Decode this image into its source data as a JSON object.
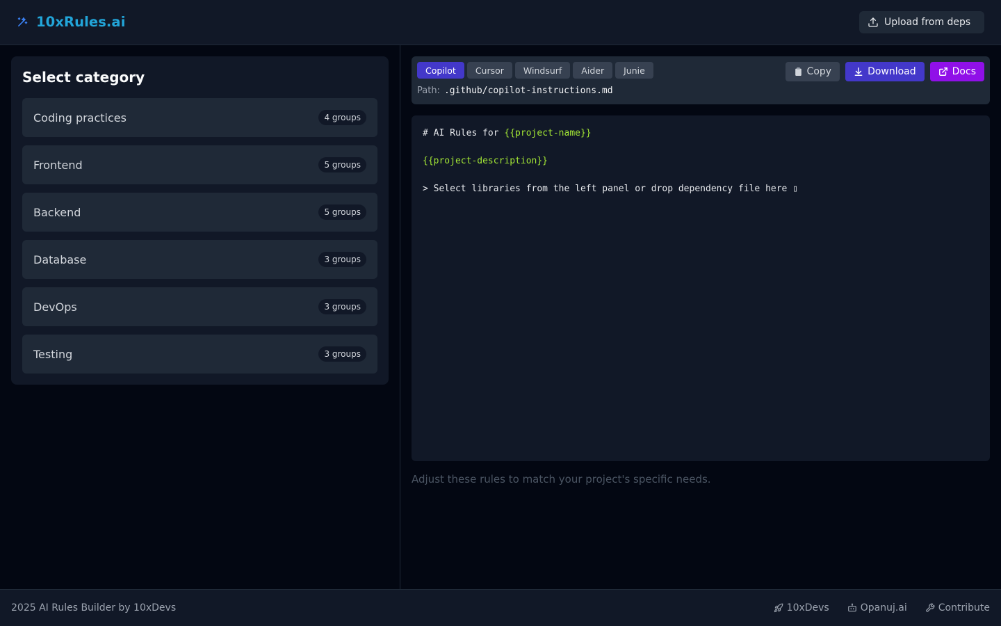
{
  "header": {
    "brand": "10xRules.ai",
    "upload_label": "Upload from deps"
  },
  "categories": {
    "title": "Select category",
    "items": [
      {
        "label": "Coding practices",
        "badge": "4 groups"
      },
      {
        "label": "Frontend",
        "badge": "5 groups"
      },
      {
        "label": "Backend",
        "badge": "5 groups"
      },
      {
        "label": "Database",
        "badge": "3 groups"
      },
      {
        "label": "DevOps",
        "badge": "3 groups"
      },
      {
        "label": "Testing",
        "badge": "3 groups"
      }
    ]
  },
  "editor": {
    "tabs": [
      "Copilot",
      "Cursor",
      "Windsurf",
      "Aider",
      "Junie"
    ],
    "active_tab": "Copilot",
    "copy_label": "Copy",
    "download_label": "Download",
    "docs_label": "Docs",
    "path_label": "Path:",
    "path_value": ".github/copilot-instructions.md",
    "line1_prefix": "# AI Rules for ",
    "line1_placeholder": "{{project-name}}",
    "line2_placeholder": "{{project-description}}",
    "line3": "> Select libraries from the left panel or drop dependency file here ▯",
    "note": "Adjust these rules to match your project's specific needs."
  },
  "footer": {
    "copyright": "2025 AI Rules Builder by 10xDevs",
    "links": [
      "10xDevs",
      "Opanuj.ai",
      "Contribute"
    ]
  },
  "colors": {
    "accent": "#4338ca",
    "docs": "#9010e8",
    "brand": "#22a5d9",
    "placeholder": "#a3e635"
  }
}
